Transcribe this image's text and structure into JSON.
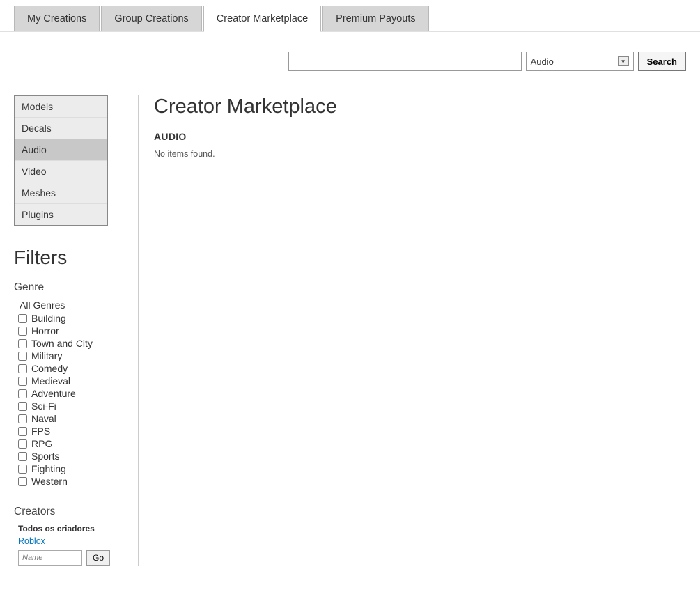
{
  "tabs": [
    {
      "label": "My Creations",
      "active": false
    },
    {
      "label": "Group Creations",
      "active": false
    },
    {
      "label": "Creator Marketplace",
      "active": true
    },
    {
      "label": "Premium Payouts",
      "active": false
    }
  ],
  "search": {
    "value": "",
    "category_selected": "Audio",
    "button_label": "Search"
  },
  "side_nav": [
    {
      "label": "Models",
      "active": false
    },
    {
      "label": "Decals",
      "active": false
    },
    {
      "label": "Audio",
      "active": true
    },
    {
      "label": "Video",
      "active": false
    },
    {
      "label": "Meshes",
      "active": false
    },
    {
      "label": "Plugins",
      "active": false
    }
  ],
  "filters": {
    "heading": "Filters",
    "genre_title": "Genre",
    "all_label": "All Genres",
    "genres": [
      "Building",
      "Horror",
      "Town and City",
      "Military",
      "Comedy",
      "Medieval",
      "Adventure",
      "Sci-Fi",
      "Naval",
      "FPS",
      "RPG",
      "Sports",
      "Fighting",
      "Western"
    ]
  },
  "creators": {
    "title": "Creators",
    "sub": "Todos os criadores",
    "link": "Roblox",
    "name_placeholder": "Name",
    "go_label": "Go"
  },
  "main": {
    "title": "Creator Marketplace",
    "section": "AUDIO",
    "empty": "No items found."
  }
}
